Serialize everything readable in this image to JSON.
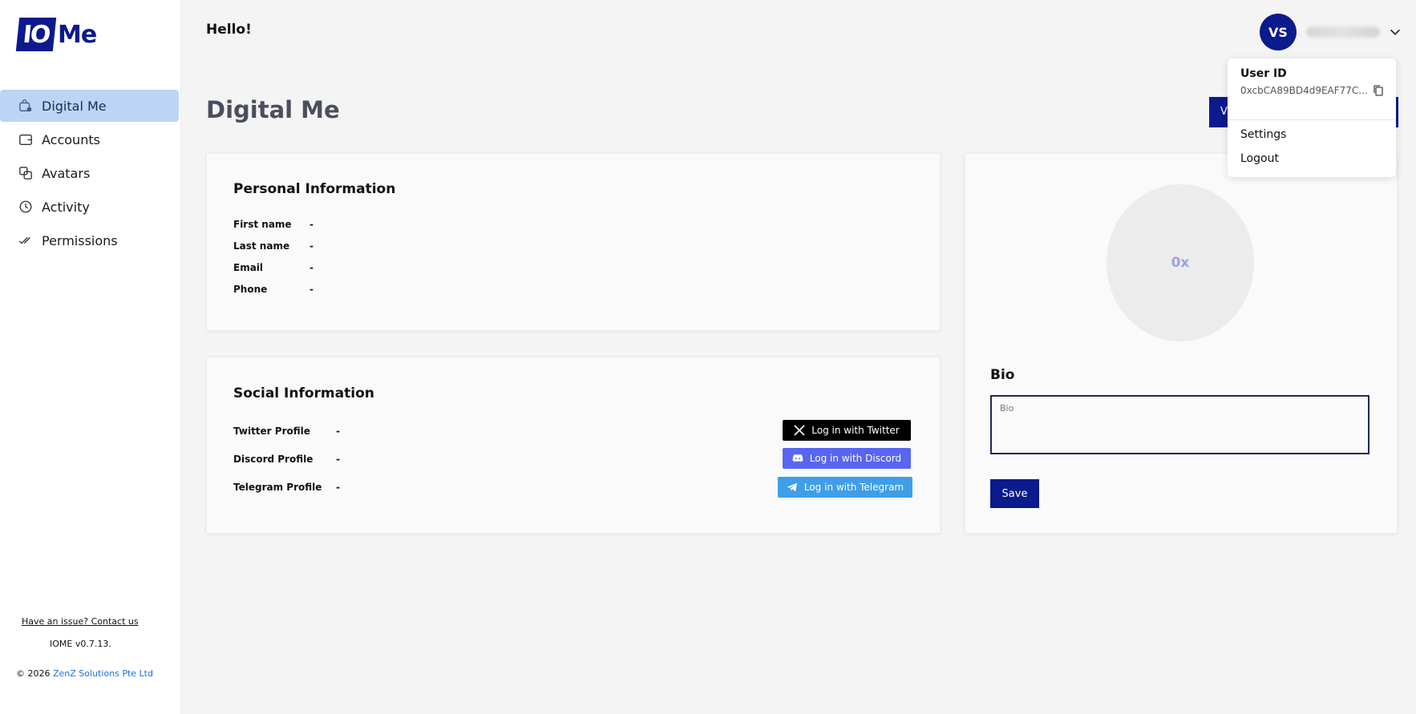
{
  "brand": {
    "logo_box": "IO",
    "logo_text": "Me"
  },
  "sidebar": {
    "items": [
      {
        "label": "Digital Me",
        "icon": "digital-me-icon",
        "active": true
      },
      {
        "label": "Accounts",
        "icon": "wallet-icon"
      },
      {
        "label": "Avatars",
        "icon": "avatars-icon"
      },
      {
        "label": "Activity",
        "icon": "clock-icon"
      },
      {
        "label": "Permissions",
        "icon": "double-check-icon"
      }
    ],
    "contact": "Have an issue? Contact us",
    "version": "IOME v0.7.13.",
    "copyright_prefix": "© 2026 ",
    "copyright_company": "ZenZ Solutions Pte Ltd"
  },
  "header": {
    "greeting": "Hello!",
    "avatar_initials": "VS"
  },
  "dropdown": {
    "user_id_label": "User ID",
    "user_id_value": "0xcbCA89BD4d9EAF77C...",
    "settings": "Settings",
    "logout": "Logout"
  },
  "page": {
    "title": "Digital Me",
    "top_button_initial": "V"
  },
  "personal": {
    "title": "Personal Information",
    "fields": [
      {
        "label": "First name",
        "value": "-"
      },
      {
        "label": "Last name",
        "value": "-"
      },
      {
        "label": "Email",
        "value": "-"
      },
      {
        "label": "Phone",
        "value": "-"
      }
    ]
  },
  "social": {
    "title": "Social Information",
    "fields": [
      {
        "label": "Twitter Profile",
        "value": "-"
      },
      {
        "label": "Discord Profile",
        "value": "-"
      },
      {
        "label": "Telegram Profile",
        "value": "-"
      }
    ],
    "buttons": {
      "twitter": "Log in with Twitter",
      "discord": "Log in with Discord",
      "telegram": "Log in with Telegram"
    }
  },
  "profile": {
    "avatar_text": "0x",
    "bio_label": "Bio",
    "bio_placeholder": "Bio",
    "save_label": "Save"
  },
  "colors": {
    "brand": "#0b1a8c",
    "active_nav": "#bcd5f7",
    "discord": "#5865f2",
    "telegram": "#3f9ee8"
  }
}
